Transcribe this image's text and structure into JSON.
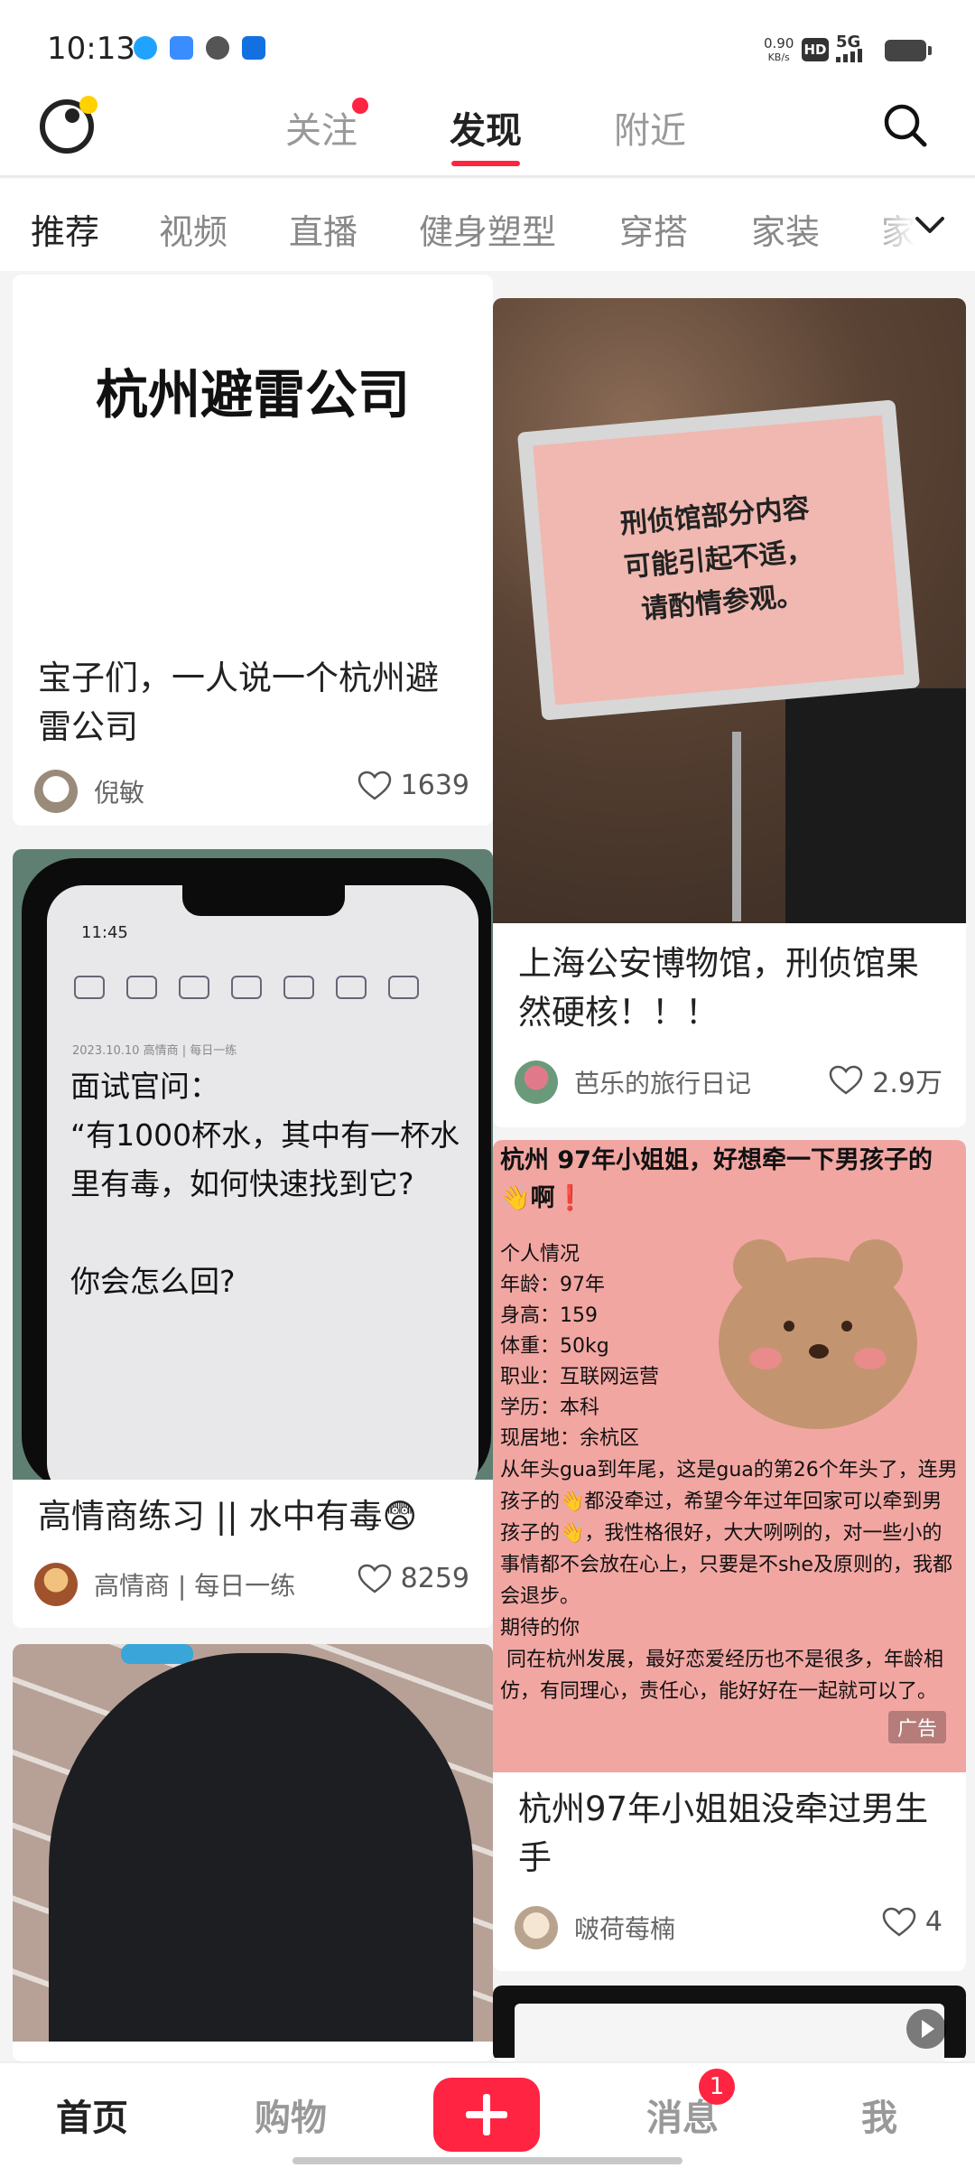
{
  "status_bar": {
    "time": "10:13",
    "net_speed": "0.90",
    "net_unit": "KB/s",
    "hd": "HD",
    "network": "5G"
  },
  "top_nav": {
    "tabs": [
      {
        "label": "关注",
        "has_dot": true
      },
      {
        "label": "发现",
        "active": true
      },
      {
        "label": "附近"
      }
    ]
  },
  "categories": [
    "推荐",
    "视频",
    "直播",
    "健身塑型",
    "穿搭",
    "家装",
    "家"
  ],
  "feed": {
    "card1": {
      "cover_text": "杭州避雷公司",
      "title_lines": [
        "宝子们，一人说一个杭州避",
        "雷公司"
      ],
      "author": "倪敏",
      "likes": "1639"
    },
    "card2": {
      "sign_lines": [
        "刑侦馆部分内容",
        "可能引起不适，",
        "请酌情参观。"
      ],
      "title_lines": [
        "上海公安博物馆，刑侦馆果",
        "然硬核！！！"
      ],
      "author": "芭乐的旅行日记",
      "likes": "2.9万"
    },
    "card3": {
      "phone_time": "11:45",
      "phone_date": "2023.10.10  高情商 | 每日一练",
      "phone_text": "面试官问：\n“有1000杯水，其中有一杯水里有毒，如何快速找到它?\n\n你会怎么回?",
      "title": "高情商练习 || 水中有毒😨",
      "author": "高情商 | 每日一练",
      "likes": "8259"
    },
    "card4": {
      "header": "杭州 97年小姐姐，好想牵一下男孩子的👋啊❗",
      "profile_title": "个人情况",
      "profile": [
        "年龄：97年",
        "身高：159",
        "体重：50kg",
        "职业：互联网运营",
        "学历：本科",
        "现居地：余杭区"
      ],
      "body": "从年头gua到年尾，这是gua的第26个年头了，连男孩子的👋都没牵过，希望今年过年回家可以牵到男孩子的👋，我性格很好，大大咧咧的，对一些小的事情都不会放在心上，只要是不she及原则的，我都会退步。\n期待的你\n 同在杭州发展，最好恋爱经历也不是很多，年龄相仿，有同理心，责任心，能好好在一起就可以了。",
      "ad_label": "广告",
      "title_lines": [
        "杭州97年小姐姐没牵过男生",
        "手"
      ],
      "author": "啵荷莓楠",
      "likes": "4"
    }
  },
  "bottom_nav": {
    "items": [
      "首页",
      "购物",
      "消息",
      "我"
    ],
    "message_badge": "1"
  },
  "colors": {
    "accent": "#ff2442",
    "text": "#222222",
    "muted": "#999999"
  }
}
